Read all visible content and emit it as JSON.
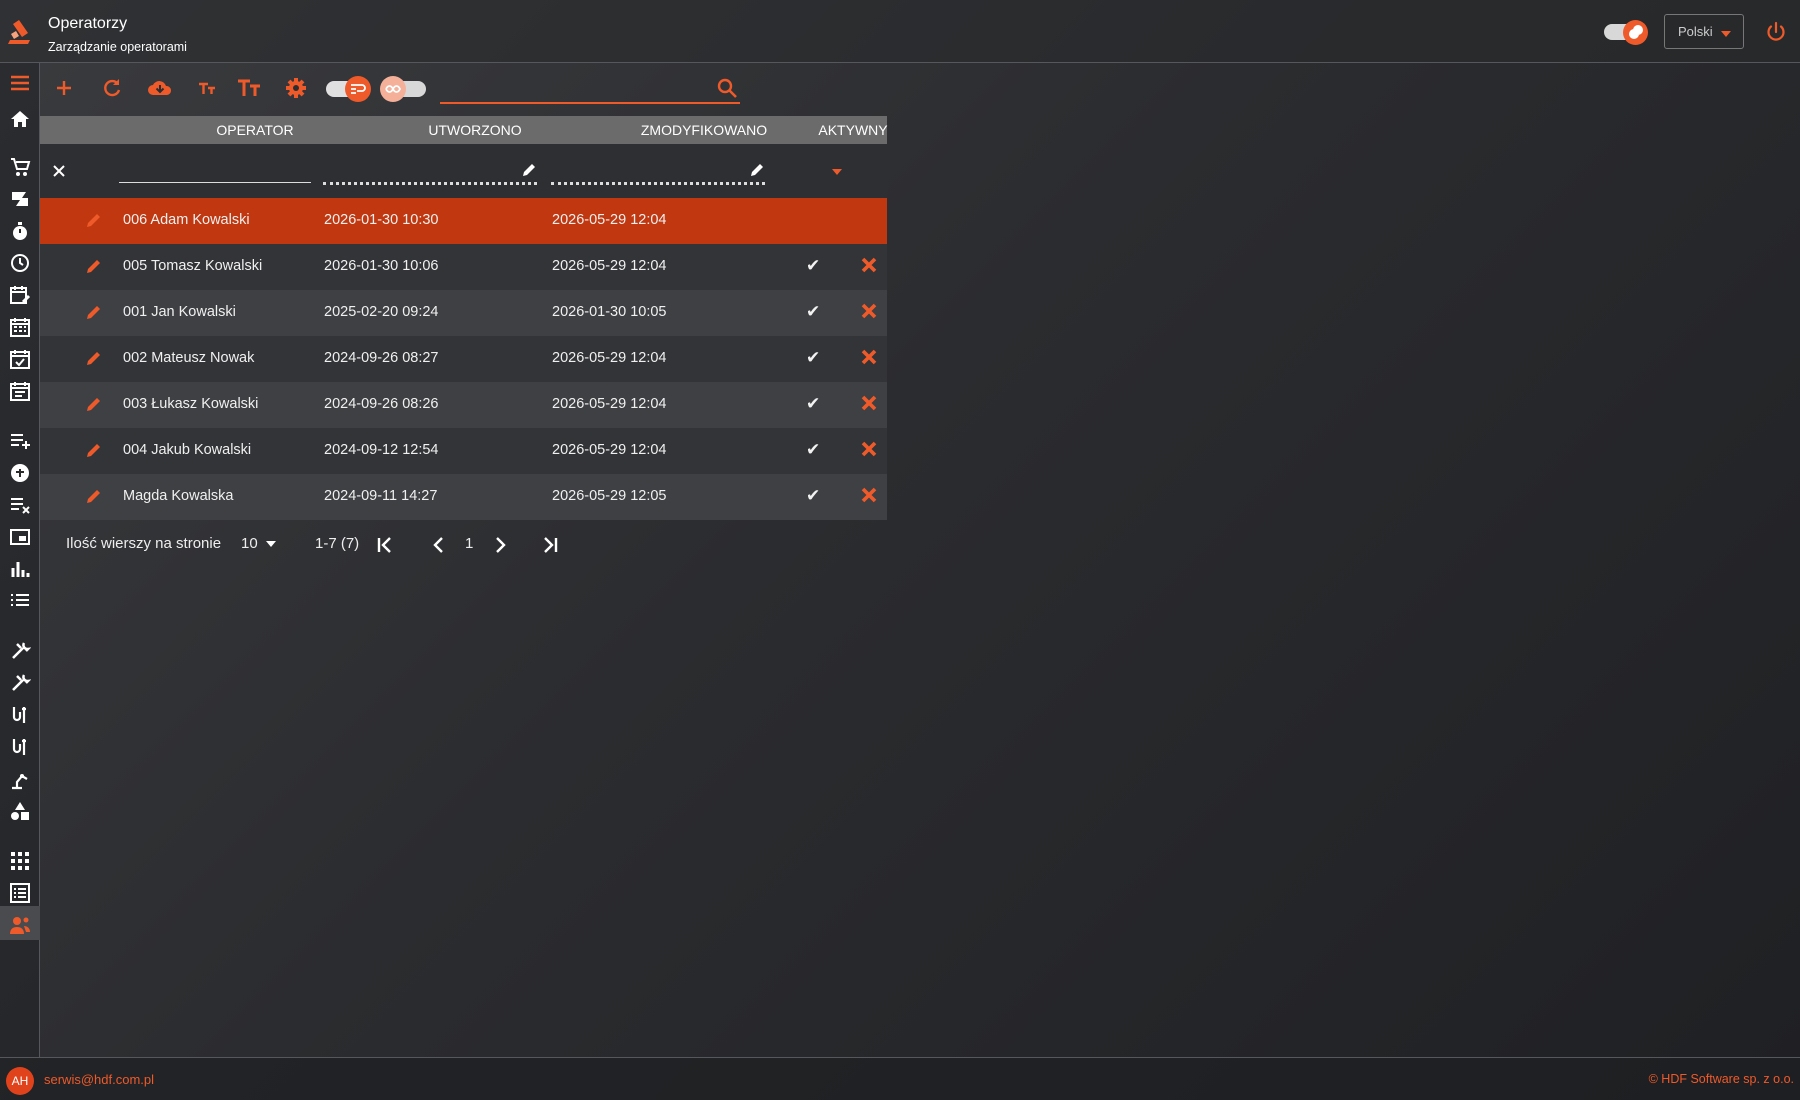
{
  "header": {
    "title": "Operatorzy",
    "subtitle": "Zarządzanie operatorami",
    "language": "Polski"
  },
  "colors": {
    "accent": "#EF5A2A",
    "selected_row": "#C1370F",
    "header_row": "#6B6B6B"
  },
  "sidebar": {
    "icons": [
      "menu-icon",
      "home-icon",
      "cart-icon",
      "production-icon",
      "stopwatch-icon",
      "clock-icon",
      "calendar-edit-icon",
      "calendar-icon",
      "calendar-check-icon",
      "calendar-list-icon",
      "playlist-add-icon",
      "pin-icon",
      "playlist-remove-icon",
      "monitor-icon",
      "bar-chart-icon",
      "list-icon",
      "tools-icon",
      "tools-icon",
      "tool-spanner-icon",
      "tool-spanner-icon",
      "robot-arm-icon",
      "shapes-icon",
      "apps-grid-icon",
      "report-list-icon",
      "operators-icon"
    ],
    "active": "operators-icon"
  },
  "toolbar": {
    "icons": [
      "add-icon",
      "refresh-icon",
      "cloud-download-icon",
      "font-small-icon",
      "font-large-icon",
      "settings-icon"
    ],
    "toggles": [
      "wrap-toggle",
      "infinite-scroll-toggle"
    ],
    "search_value": ""
  },
  "table": {
    "columns": [
      "OPERATOR",
      "UTWORZONO",
      "ZMODYFIKOWANO",
      "AKTYWNY"
    ],
    "rows": [
      {
        "operator": "006 Adam Kowalski",
        "created": "2026-01-30 10:30",
        "modified": "2026-05-29 12:04",
        "active": "",
        "selected": true
      },
      {
        "operator": "005 Tomasz Kowalski",
        "created": "2026-01-30 10:06",
        "modified": "2026-05-29 12:04",
        "active": "✔"
      },
      {
        "operator": "001 Jan Kowalski",
        "created": "2025-02-20 09:24",
        "modified": "2026-01-30 10:05",
        "active": "✔"
      },
      {
        "operator": "002 Mateusz Nowak",
        "created": "2024-09-26 08:27",
        "modified": "2026-05-29 12:04",
        "active": "✔"
      },
      {
        "operator": "003 Łukasz Kowalski",
        "created": "2024-09-26 08:26",
        "modified": "2026-05-29 12:04",
        "active": "✔"
      },
      {
        "operator": "004 Jakub Kowalski",
        "created": "2024-09-12 12:54",
        "modified": "2026-05-29 12:04",
        "active": "✔"
      },
      {
        "operator": "Magda Kowalska",
        "created": "2024-09-11 14:27",
        "modified": "2026-05-29 12:05",
        "active": "✔"
      }
    ]
  },
  "pager": {
    "label": "Ilość wierszy na stronie",
    "per_page": "10",
    "range": "1-7 (7)",
    "page": "1"
  },
  "footer": {
    "avatar": "AH",
    "email": "serwis@hdf.com.pl",
    "copyright": "© HDF Software sp. z o.o."
  }
}
